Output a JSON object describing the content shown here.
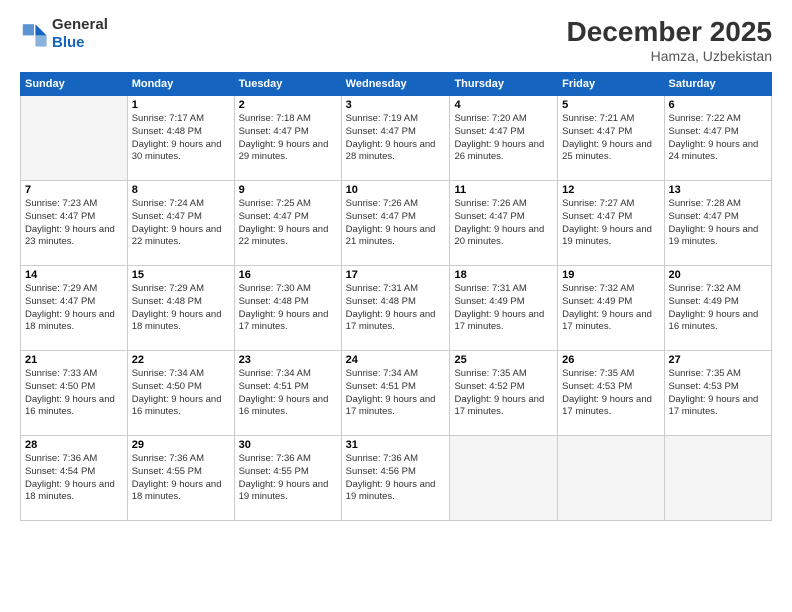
{
  "header": {
    "logo_line1": "General",
    "logo_line2": "Blue",
    "month_year": "December 2025",
    "location": "Hamza, Uzbekistan"
  },
  "weekdays": [
    "Sunday",
    "Monday",
    "Tuesday",
    "Wednesday",
    "Thursday",
    "Friday",
    "Saturday"
  ],
  "weeks": [
    [
      {
        "day": "",
        "empty": true
      },
      {
        "day": "1",
        "sunrise": "7:17 AM",
        "sunset": "4:48 PM",
        "daylight": "9 hours and 30 minutes."
      },
      {
        "day": "2",
        "sunrise": "7:18 AM",
        "sunset": "4:47 PM",
        "daylight": "9 hours and 29 minutes."
      },
      {
        "day": "3",
        "sunrise": "7:19 AM",
        "sunset": "4:47 PM",
        "daylight": "9 hours and 28 minutes."
      },
      {
        "day": "4",
        "sunrise": "7:20 AM",
        "sunset": "4:47 PM",
        "daylight": "9 hours and 26 minutes."
      },
      {
        "day": "5",
        "sunrise": "7:21 AM",
        "sunset": "4:47 PM",
        "daylight": "9 hours and 25 minutes."
      },
      {
        "day": "6",
        "sunrise": "7:22 AM",
        "sunset": "4:47 PM",
        "daylight": "9 hours and 24 minutes."
      }
    ],
    [
      {
        "day": "7",
        "sunrise": "7:23 AM",
        "sunset": "4:47 PM",
        "daylight": "9 hours and 23 minutes."
      },
      {
        "day": "8",
        "sunrise": "7:24 AM",
        "sunset": "4:47 PM",
        "daylight": "9 hours and 22 minutes."
      },
      {
        "day": "9",
        "sunrise": "7:25 AM",
        "sunset": "4:47 PM",
        "daylight": "9 hours and 22 minutes."
      },
      {
        "day": "10",
        "sunrise": "7:26 AM",
        "sunset": "4:47 PM",
        "daylight": "9 hours and 21 minutes."
      },
      {
        "day": "11",
        "sunrise": "7:26 AM",
        "sunset": "4:47 PM",
        "daylight": "9 hours and 20 minutes."
      },
      {
        "day": "12",
        "sunrise": "7:27 AM",
        "sunset": "4:47 PM",
        "daylight": "9 hours and 19 minutes."
      },
      {
        "day": "13",
        "sunrise": "7:28 AM",
        "sunset": "4:47 PM",
        "daylight": "9 hours and 19 minutes."
      }
    ],
    [
      {
        "day": "14",
        "sunrise": "7:29 AM",
        "sunset": "4:47 PM",
        "daylight": "9 hours and 18 minutes."
      },
      {
        "day": "15",
        "sunrise": "7:29 AM",
        "sunset": "4:48 PM",
        "daylight": "9 hours and 18 minutes."
      },
      {
        "day": "16",
        "sunrise": "7:30 AM",
        "sunset": "4:48 PM",
        "daylight": "9 hours and 17 minutes."
      },
      {
        "day": "17",
        "sunrise": "7:31 AM",
        "sunset": "4:48 PM",
        "daylight": "9 hours and 17 minutes."
      },
      {
        "day": "18",
        "sunrise": "7:31 AM",
        "sunset": "4:49 PM",
        "daylight": "9 hours and 17 minutes."
      },
      {
        "day": "19",
        "sunrise": "7:32 AM",
        "sunset": "4:49 PM",
        "daylight": "9 hours and 17 minutes."
      },
      {
        "day": "20",
        "sunrise": "7:32 AM",
        "sunset": "4:49 PM",
        "daylight": "9 hours and 16 minutes."
      }
    ],
    [
      {
        "day": "21",
        "sunrise": "7:33 AM",
        "sunset": "4:50 PM",
        "daylight": "9 hours and 16 minutes."
      },
      {
        "day": "22",
        "sunrise": "7:34 AM",
        "sunset": "4:50 PM",
        "daylight": "9 hours and 16 minutes."
      },
      {
        "day": "23",
        "sunrise": "7:34 AM",
        "sunset": "4:51 PM",
        "daylight": "9 hours and 16 minutes."
      },
      {
        "day": "24",
        "sunrise": "7:34 AM",
        "sunset": "4:51 PM",
        "daylight": "9 hours and 17 minutes."
      },
      {
        "day": "25",
        "sunrise": "7:35 AM",
        "sunset": "4:52 PM",
        "daylight": "9 hours and 17 minutes."
      },
      {
        "day": "26",
        "sunrise": "7:35 AM",
        "sunset": "4:53 PM",
        "daylight": "9 hours and 17 minutes."
      },
      {
        "day": "27",
        "sunrise": "7:35 AM",
        "sunset": "4:53 PM",
        "daylight": "9 hours and 17 minutes."
      }
    ],
    [
      {
        "day": "28",
        "sunrise": "7:36 AM",
        "sunset": "4:54 PM",
        "daylight": "9 hours and 18 minutes."
      },
      {
        "day": "29",
        "sunrise": "7:36 AM",
        "sunset": "4:55 PM",
        "daylight": "9 hours and 18 minutes."
      },
      {
        "day": "30",
        "sunrise": "7:36 AM",
        "sunset": "4:55 PM",
        "daylight": "9 hours and 19 minutes."
      },
      {
        "day": "31",
        "sunrise": "7:36 AM",
        "sunset": "4:56 PM",
        "daylight": "9 hours and 19 minutes."
      },
      {
        "day": "",
        "empty": true
      },
      {
        "day": "",
        "empty": true
      },
      {
        "day": "",
        "empty": true
      }
    ]
  ]
}
